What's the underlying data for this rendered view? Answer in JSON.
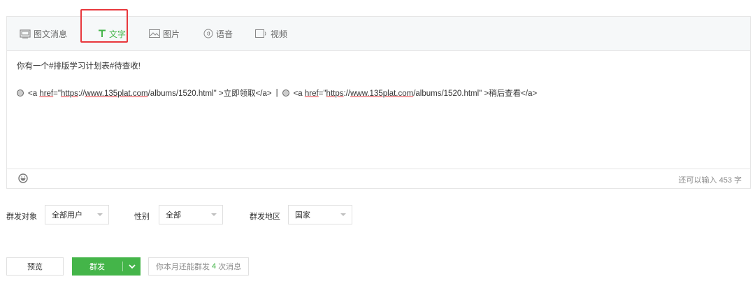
{
  "tabs": [
    {
      "label": "图文消息",
      "icon": "news-icon"
    },
    {
      "label": "文字",
      "icon": "text-icon",
      "active": true
    },
    {
      "label": "图片",
      "icon": "image-icon"
    },
    {
      "label": "语音",
      "icon": "voice-icon"
    },
    {
      "label": "视频",
      "icon": "video-icon"
    }
  ],
  "content": {
    "line1": "你有一个#排版学习计划表#待查收!",
    "link1": {
      "pre": "<a ",
      "href_attr": "href",
      "mid1": "=\"",
      "url_proto": "https",
      "mid2": "://",
      "url_domain": "www.135plat.com",
      "url_path": "/albums/1520.html\" >立即领取</a>"
    },
    "separator": "|",
    "link2": {
      "pre": "<a ",
      "href_attr": "href",
      "mid1": "=\"",
      "url_proto": "https",
      "mid2": "://",
      "url_domain": "www.135plat.com",
      "url_path": "/albums/1520.html\" >稍后查看</a>"
    }
  },
  "footer": {
    "char_count": "还可以输入 453 字"
  },
  "filters": {
    "target_label": "群发对象",
    "target_value": "全部用户",
    "gender_label": "性别",
    "gender_value": "全部",
    "region_label": "群发地区",
    "region_value": "国家"
  },
  "actions": {
    "preview": "预览",
    "send": "群发",
    "quota_pre": "你本月还能群发",
    "quota_num": "4",
    "quota_post": "次消息"
  },
  "colors": {
    "accent": "#44b549",
    "highlight": "#e8383d"
  }
}
